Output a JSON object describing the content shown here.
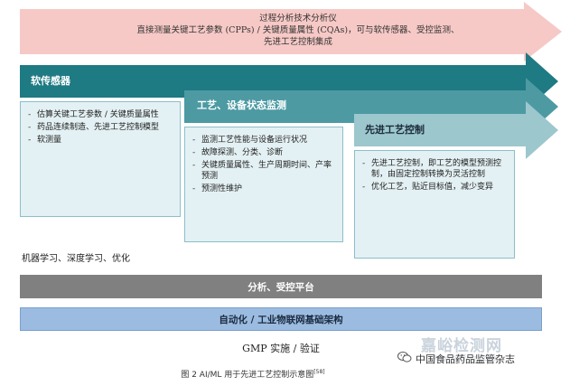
{
  "pat": {
    "title": "过程分析技术分析仪",
    "line2": "直接测量关键工艺参数 (CPPs) / 关键质量属性 (CQAs)，可与软传感器、受控监测、",
    "line3": "先进工艺控制集成"
  },
  "soft_sensor": {
    "title": "软传感器",
    "items": [
      "估算关键工艺参数 / 关键质量属性",
      "药品连续制造、先进工艺控制模型",
      "软测量"
    ]
  },
  "process_monitoring": {
    "title": "工艺、设备状态监测",
    "items": [
      "监测工艺性能与设备运行状况",
      "故障探测、分类、诊断",
      "关键质量属性、生产周期时间、产率预测",
      "预测性维护"
    ]
  },
  "apc": {
    "title": "先进工艺控制",
    "items": [
      "先进工艺控制，即工艺的模型预测控制，由固定控制转换为灵活控制",
      "优化工艺，贴近目标值，减少变异"
    ]
  },
  "ml_label": "机器学习、深度学习、优化",
  "analytics_bar": "分析、受控平台",
  "automation_bar": "自动化 / 工业物联网基础架构",
  "gmp_label": "GMP 实施 / 验证",
  "caption": "图 2   AI/ML 用于先进工艺控制示意图",
  "caption_ref": "[58]",
  "brand": "中国食品药品监管杂志",
  "watermark": "嘉峪检测网",
  "watermark_sub": "AnyTesting.com",
  "colors": {
    "pat_arrow": "#f6c9c6",
    "soft_sensor_arrow": "#1e7a83",
    "monitoring_arrow": "#4d9aa3",
    "apc_arrow": "#9cc7cd",
    "analytics_bar": "#808080",
    "automation_bar": "#9bbce0"
  }
}
